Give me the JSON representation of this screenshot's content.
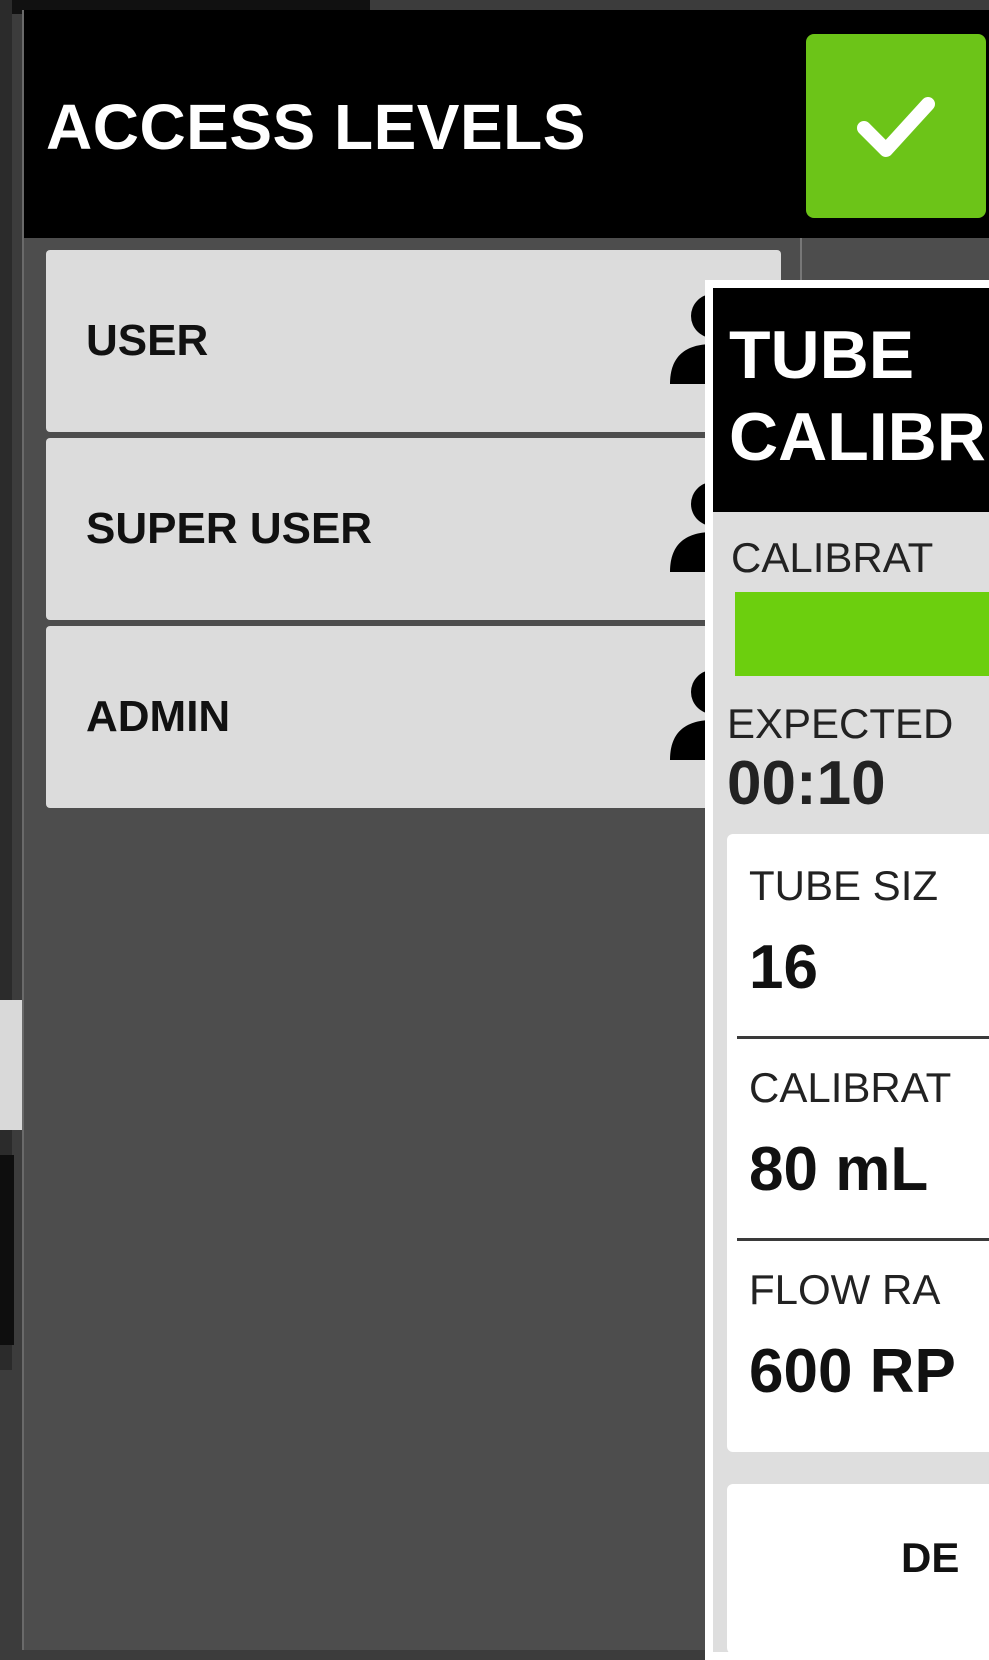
{
  "access_levels": {
    "title": "ACCESS LEVELS",
    "items": [
      {
        "label": "USER",
        "icon": "user-icon"
      },
      {
        "label": "SUPER USER",
        "icon": "user-icon"
      },
      {
        "label": "ADMIN",
        "icon": "user-icon"
      }
    ]
  },
  "tube_calibration": {
    "title_line1": "TUBE",
    "title_line2": "CALIBR",
    "calibration_label": "CALIBRAT",
    "expected_label": "EXPECTED",
    "expected_value": "00:10",
    "settings": [
      {
        "label": "TUBE SIZ",
        "value": "16"
      },
      {
        "label": "CALIBRAT",
        "value": "80 mL"
      },
      {
        "label": "FLOW RA",
        "value": "600 RP"
      }
    ],
    "bottom_button_label": "DE"
  },
  "colors": {
    "accent_green": "#6cc418",
    "header_black": "#000000",
    "panel_gray": "#4d4d4d",
    "item_gray": "#dcdcdc"
  }
}
